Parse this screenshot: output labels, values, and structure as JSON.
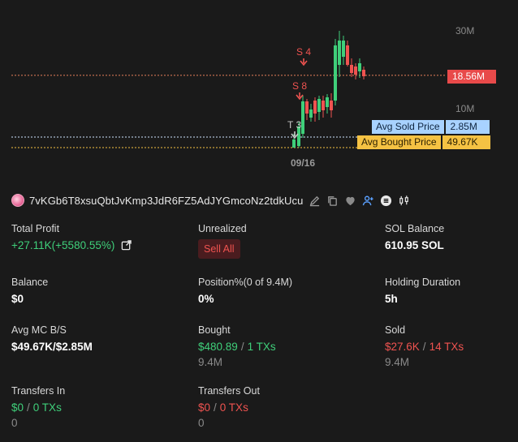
{
  "chart": {
    "y_ticks": [
      {
        "label": "30M",
        "value": 30000000
      },
      {
        "label": "10M",
        "value": 10000000
      }
    ],
    "date_label": "09/16",
    "current_price_label": "18.56M",
    "current_price_value": 18560000,
    "avg_sold_label": "Avg Sold Price",
    "avg_sold_value": "2.85M",
    "avg_bought_label": "Avg Bought Price",
    "avg_bought_value": "49.67K",
    "trade_marks": [
      {
        "label": "S 4",
        "type": "sell"
      },
      {
        "label": "S 8",
        "type": "sell"
      },
      {
        "label": "T 3",
        "type": "transfer"
      }
    ],
    "colors": {
      "up": "#3fcf7a",
      "down": "#ef5350",
      "background": "#1a1a1a",
      "current_line": "#e8805a"
    }
  },
  "token": {
    "address": "7vKGb6T8xsuQbtJvKmp3JdR6FZ5AdJYGmcoNz2tdkUcu",
    "icons": [
      "edit-icon",
      "copy-icon",
      "heart-icon",
      "user-add-icon",
      "list-icon",
      "candles-icon"
    ]
  },
  "stats": {
    "total_profit": {
      "label": "Total Profit",
      "value": "+27.11K(+5580.55%)"
    },
    "unrealized": {
      "label": "Unrealized",
      "button": "Sell All"
    },
    "sol_balance": {
      "label": "SOL Balance",
      "value": "610.95 SOL"
    },
    "balance": {
      "label": "Balance",
      "value": "$0"
    },
    "position": {
      "label": "Position%(0 of 9.4M)",
      "value": "0%"
    },
    "holding_duration": {
      "label": "Holding Duration",
      "value": "5h"
    },
    "avg_mc": {
      "label": "Avg MC B/S",
      "value": "$49.67K/$2.85M"
    },
    "bought": {
      "label": "Bought",
      "amount": "$480.89",
      "sep": "/",
      "txs": "1 TXs",
      "sub": "9.4M"
    },
    "sold": {
      "label": "Sold",
      "amount": "$27.6K",
      "sep": "/",
      "txs": "14 TXs",
      "sub": "9.4M"
    },
    "transfers_in": {
      "label": "Transfers In",
      "amount": "$0",
      "sep": "/",
      "txs": "0 TXs",
      "sub": "0"
    },
    "transfers_out": {
      "label": "Transfers Out",
      "amount": "$0",
      "sep": "/",
      "txs": "0 TXs",
      "sub": "0"
    }
  }
}
